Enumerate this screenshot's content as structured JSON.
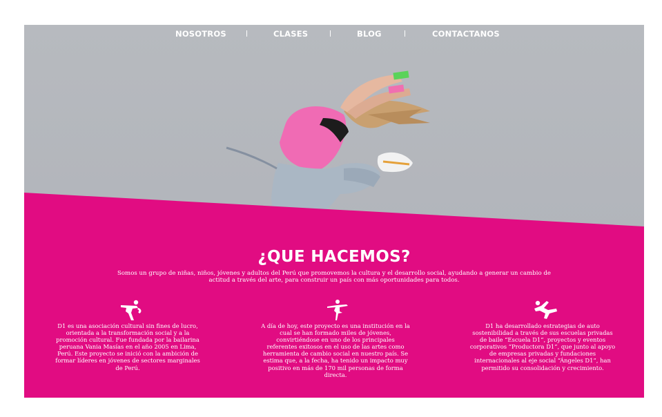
{
  "nav": {
    "items": [
      "NOSOTROS",
      "CLASES",
      "BLOG",
      "CONTACTANOS"
    ],
    "separator": "|"
  },
  "colors": {
    "accent": "#e10c82",
    "hero_bg": "#b4b7bd",
    "text": "#ffffff"
  },
  "hero": {
    "image": "dancer-jumping-photo"
  },
  "section": {
    "title": "¿QUE HACEMOS?",
    "intro": "Somos un grupo de niñas, niños, jóvenes y adultos del Perú que promovemos la cultura y el desarrollo social, ayudando a generar un cambio de actitud a través del arte, para construir un país con más oportunidades para todos."
  },
  "columns": [
    {
      "icon": "dancer-pose-icon",
      "text": "D1 es una asociación cultural sin fines de lucro, orientada a la transformación social y a la promoción cultural. Fue fundada por la bailarina peruana Vania Masías en el año 2005 en Lima, Perú. Este proyecto se inició con la ambición de formar líderes en jóvenes de sectores marginales de Perú."
    },
    {
      "icon": "ballet-dancer-icon",
      "text": "A día de hoy, este proyecto es una institución en la cual se han formado miles de jóvenes, convirtiéndose en uno de los principales referentes exitosos en el uso de las artes como herramienta de cambio social en nuestro país. Se estima que, a la fecha, ha tenido un impacto muy positivo en más de 170 mil personas de forma directa."
    },
    {
      "icon": "breakdancer-icon",
      "text": "D1 ha desarrollado estrategias de auto sostenibilidad a través de sus escuelas privadas de baile “Escuela D1”, proyectos y eventos corporativos “Productora D1”, que junto al apoyo de empresas privadas y fundaciones internacionales al eje social “Ángeles D1”, han permitido su consolidación y crecimiento."
    }
  ]
}
